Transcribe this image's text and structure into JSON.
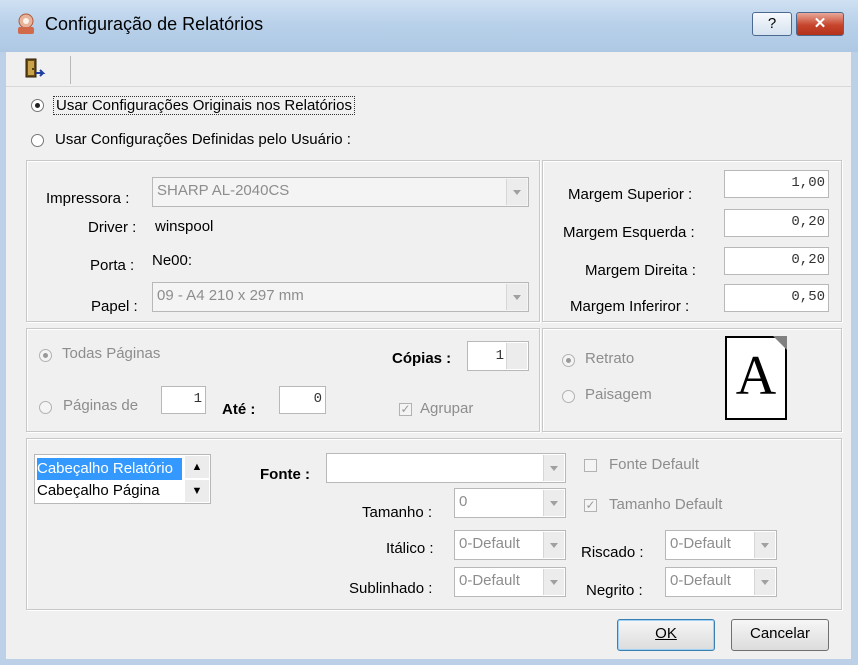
{
  "window": {
    "title": "Configuração de Relatórios",
    "help_label": "?",
    "close_label": "✕"
  },
  "toolbar": {
    "exit_icon": "exit-door-icon"
  },
  "mode": {
    "original_label": "Usar Configurações Originais nos Relatórios",
    "user_label": "Usar Configurações Definidas pelo Usuário :",
    "selected": "original"
  },
  "printer": {
    "impressora_label": "Impressora :",
    "impressora_value": "SHARP AL-2040CS",
    "driver_label": "Driver :",
    "driver_value": "winspool",
    "porta_label": "Porta :",
    "porta_value": "Ne00:",
    "papel_label": "Papel :",
    "papel_value": "09  - A4 210 x 297 mm"
  },
  "margins": {
    "superior_label": "Margem Superior :",
    "superior_value": "1,00",
    "esquerda_label": "Margem Esquerda :",
    "esquerda_value": "0,20",
    "direita_label": "Margem Direita :",
    "direita_value": "0,20",
    "inferior_label": "Margem Inferiror :",
    "inferior_value": "0,50"
  },
  "pages": {
    "todas_label": "Todas Páginas",
    "paginas_de_label": "Páginas de",
    "paginas_de_value": "1",
    "ate_label": "Até :",
    "ate_value": "0",
    "copias_label": "Cópias :",
    "copias_value": "1",
    "agrupar_label": "Agrupar",
    "agrupar_checked": true
  },
  "orientation": {
    "retrato_label": "Retrato",
    "paisagem_label": "Paisagem",
    "selected": "retrato",
    "preview_letter": "A"
  },
  "fonts": {
    "sections": [
      "Cabeçalho Relatório",
      "Cabeçalho Página"
    ],
    "selected_section": 0,
    "fonte_label": "Fonte :",
    "fonte_value": "",
    "fonte_default_label": "Fonte Default",
    "fonte_default_checked": false,
    "tamanho_label": "Tamanho :",
    "tamanho_value": "0",
    "tamanho_default_label": "Tamanho Default",
    "tamanho_default_checked": true,
    "italico_label": "Itálico :",
    "italico_value": "0-Default",
    "riscado_label": "Riscado :",
    "riscado_value": "0-Default",
    "sublinhado_label": "Sublinhado :",
    "sublinhado_value": "0-Default",
    "negrito_label": "Negrito :",
    "negrito_value": "0-Default"
  },
  "buttons": {
    "ok_label": "OK",
    "cancel_label": "Cancelar"
  }
}
